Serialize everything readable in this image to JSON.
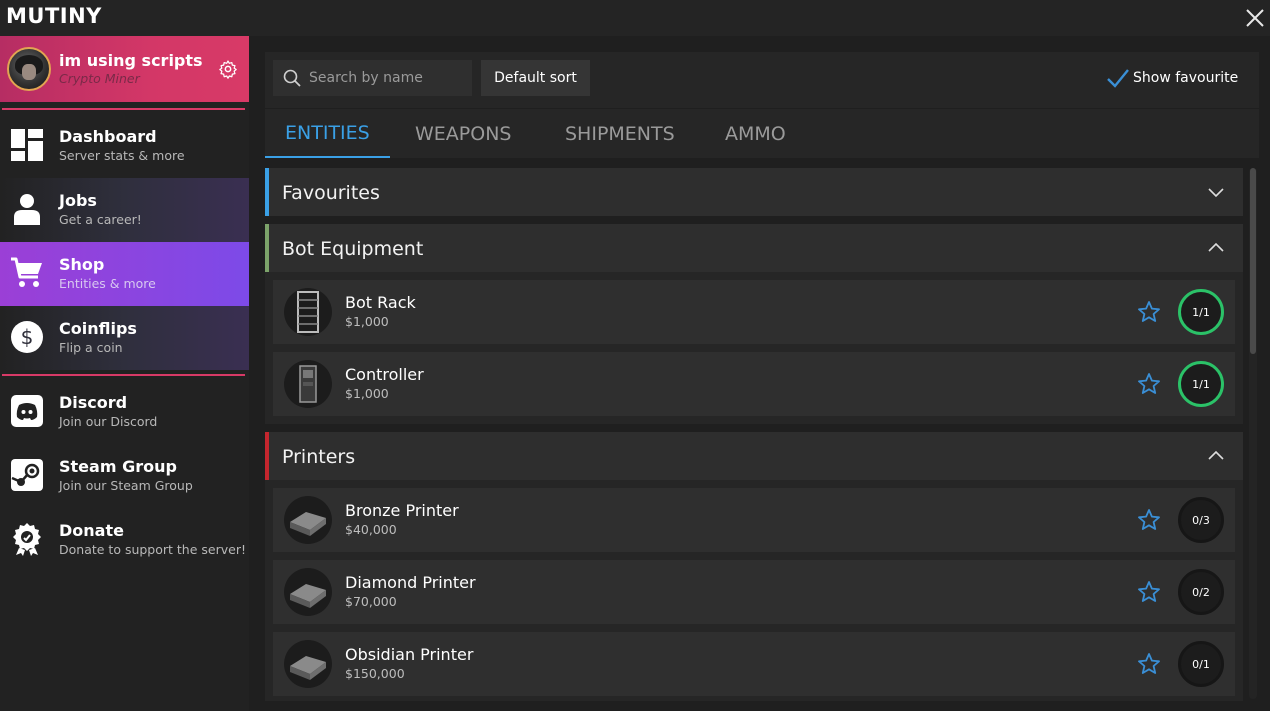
{
  "app": {
    "title": "MUTINY"
  },
  "profile": {
    "name": "im using scripts",
    "role": "Crypto Miner"
  },
  "nav": {
    "dashboard": {
      "label": "Dashboard",
      "sub": "Server stats & more"
    },
    "jobs": {
      "label": "Jobs",
      "sub": "Get a career!"
    },
    "shop": {
      "label": "Shop",
      "sub": "Entities & more"
    },
    "coinflips": {
      "label": "Coinflips",
      "sub": "Flip a coin"
    },
    "discord": {
      "label": "Discord",
      "sub": "Join our Discord"
    },
    "steam": {
      "label": "Steam Group",
      "sub": "Join our Steam Group"
    },
    "donate": {
      "label": "Donate",
      "sub": "Donate to support the server!"
    }
  },
  "toolbar": {
    "search_placeholder": "Search by name",
    "sort_label": "Default sort",
    "show_favourite_label": "Show favourite",
    "show_favourite_checked": true
  },
  "tabs": [
    "ENTITIES",
    "WEAPONS",
    "SHIPMENTS",
    "AMMO"
  ],
  "active_tab": "ENTITIES",
  "categories": [
    {
      "title": "Favourites",
      "color": "#3aa0e6",
      "expanded": false,
      "items": []
    },
    {
      "title": "Bot Equipment",
      "color": "#7ca36a",
      "expanded": true,
      "items": [
        {
          "name": "Bot Rack",
          "price": "$1,000",
          "limit": "1/1",
          "at_limit": true
        },
        {
          "name": "Controller",
          "price": "$1,000",
          "limit": "1/1",
          "at_limit": true
        }
      ]
    },
    {
      "title": "Printers",
      "color": "#c4262e",
      "expanded": true,
      "items": [
        {
          "name": "Bronze Printer",
          "price": "$40,000",
          "limit": "0/3",
          "at_limit": false
        },
        {
          "name": "Diamond Printer",
          "price": "$70,000",
          "limit": "0/2",
          "at_limit": false
        },
        {
          "name": "Obsidian Printer",
          "price": "$150,000",
          "limit": "0/1",
          "at_limit": false
        }
      ]
    }
  ],
  "colors": {
    "accent": "#3aa0e6",
    "profile_bg": "#d33767",
    "shop_active": "#8a44e0",
    "limit_full": "#2bc268",
    "star": "#3a8fd6"
  },
  "icons": {
    "close": "close-icon",
    "settings": "gear-icon",
    "dashboard": "dashboard-grid-icon",
    "jobs": "person-icon",
    "shop": "shopping-cart-icon",
    "coinflips": "dollar-coin-icon",
    "discord": "discord-icon",
    "steam": "steam-icon",
    "donate": "award-ribbon-icon",
    "search": "search-icon",
    "favourite": "star-icon",
    "expand": "chevron-down-icon",
    "collapse": "chevron-up-icon",
    "check": "checkmark-icon"
  }
}
